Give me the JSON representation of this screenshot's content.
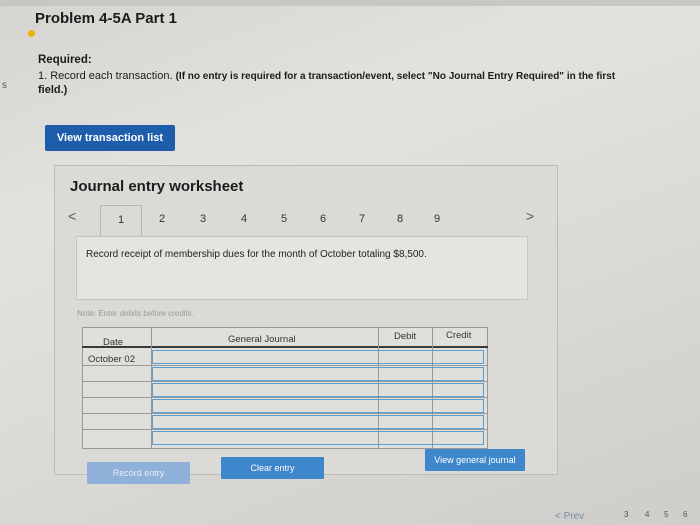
{
  "header": {
    "title": "Problem 4-5A Part 1",
    "required_label": "Required:",
    "instruction_prefix": "1. Record each transaction.",
    "instruction_bold": "(If no entry is required for a transaction/event, select \"No Journal Entry Required\" in the first",
    "instruction_continuation": "field.)",
    "left_edge_letter": "s"
  },
  "buttons": {
    "view_transaction_list": "View transaction list",
    "record_entry": "Record entry",
    "clear_entry": "Clear entry",
    "view_general_journal": "View general journal"
  },
  "worksheet": {
    "title": "Journal entry worksheet",
    "prev": "<",
    "next": ">",
    "tabs": [
      "1",
      "2",
      "3",
      "4",
      "5",
      "6",
      "7",
      "8",
      "9"
    ],
    "active_tab": "1",
    "description": "Record receipt of membership dues for the month of October totaling $8,500.",
    "note": "Note: Enter debits before credits.",
    "table": {
      "headers": {
        "date": "Date",
        "general_journal": "General Journal",
        "debit": "Debit",
        "credit": "Credit"
      },
      "first_date": "October 02"
    }
  },
  "footer": {
    "prev": "Prev",
    "pages": [
      "3",
      "4",
      "5",
      "6"
    ]
  },
  "colors": {
    "primary_button": "#1d5dab",
    "secondary_button": "#3f87cc",
    "disabled_button": "#8fb0d8",
    "title_dot": "#e8b400"
  }
}
